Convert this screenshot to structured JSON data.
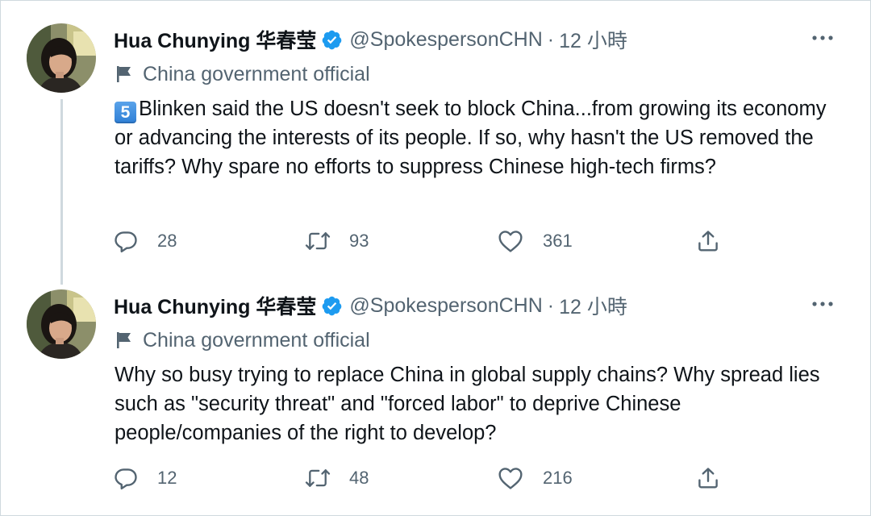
{
  "tweets": [
    {
      "author": {
        "name": "Hua Chunying 华春莹",
        "handle": "@SpokespersonCHN",
        "time": "12 小時",
        "separator": "·",
        "label": "China government official"
      },
      "keycap": "5",
      "text": "Blinken said the US doesn't seek to block China...from growing its economy or advancing the interests of its people. If so, why hasn't the US removed the tariffs? Why spare no efforts to suppress Chinese high-tech firms?",
      "stats": {
        "replies": "28",
        "retweets": "93",
        "likes": "361"
      }
    },
    {
      "author": {
        "name": "Hua Chunying 华春莹",
        "handle": "@SpokespersonCHN",
        "time": "12 小時",
        "separator": "·",
        "label": "China government official"
      },
      "text": "Why so busy trying to replace China in global supply chains? Why spread lies such as \"security threat\" and \"forced labor\" to deprive Chinese people/companies of the right to develop?",
      "stats": {
        "replies": "12",
        "retweets": "48",
        "likes": "216"
      }
    }
  ],
  "colors": {
    "text_primary": "#0f1419",
    "text_secondary": "#536471",
    "verified": "#1d9bf0",
    "divider": "#cfd9de"
  },
  "icons": [
    "verified-badge-icon",
    "more-options-icon",
    "government-flag-icon",
    "reply-icon",
    "retweet-icon",
    "like-icon",
    "share-icon"
  ]
}
